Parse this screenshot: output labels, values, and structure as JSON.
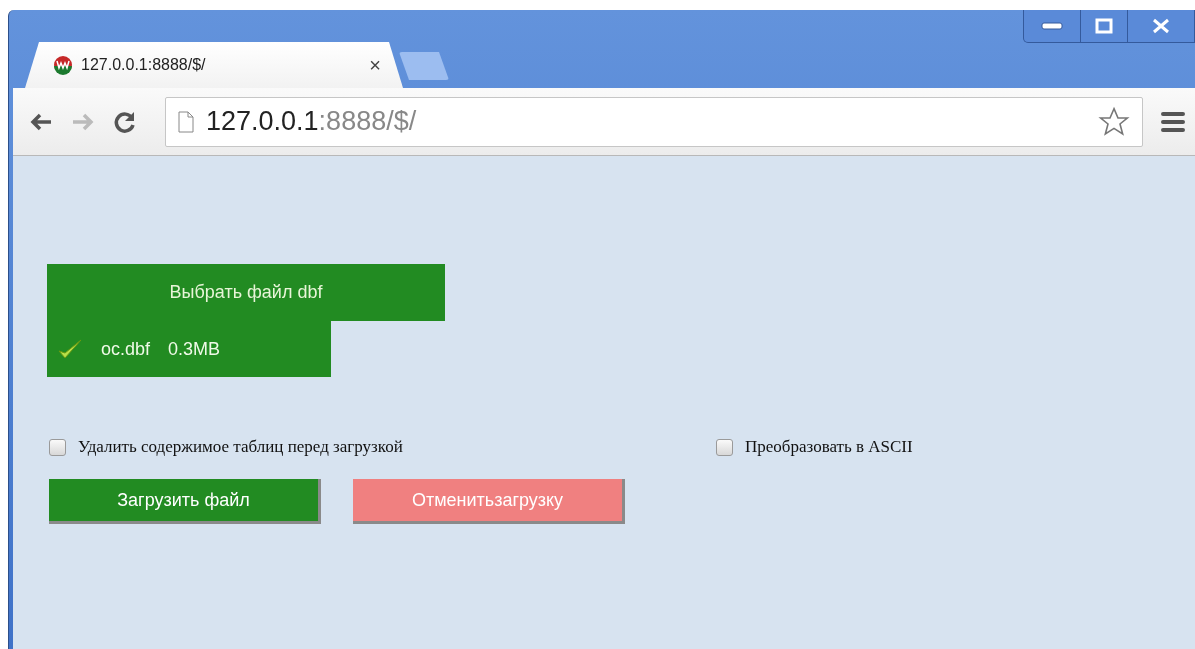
{
  "browser": {
    "tab": {
      "title": "127.0.0.1:8888/$/",
      "close": "×"
    },
    "address_bar": {
      "host": "127.0.0.1",
      "path": ":8888/$/"
    }
  },
  "upload": {
    "choose_button": "Выбрать файл dbf",
    "file": {
      "name": "oc.dbf",
      "size": "0.3MB",
      "uploaded": true
    }
  },
  "options": [
    {
      "label": "Удалить содержимое таблиц перед загрузкой",
      "checked": false
    },
    {
      "label": "Преобразовать в ASCII",
      "checked": false
    }
  ],
  "buttons": [
    {
      "label": "Загрузить файл",
      "kind": "primary"
    },
    {
      "label": "Отменитьзагрузку",
      "kind": "cancel"
    }
  ]
}
